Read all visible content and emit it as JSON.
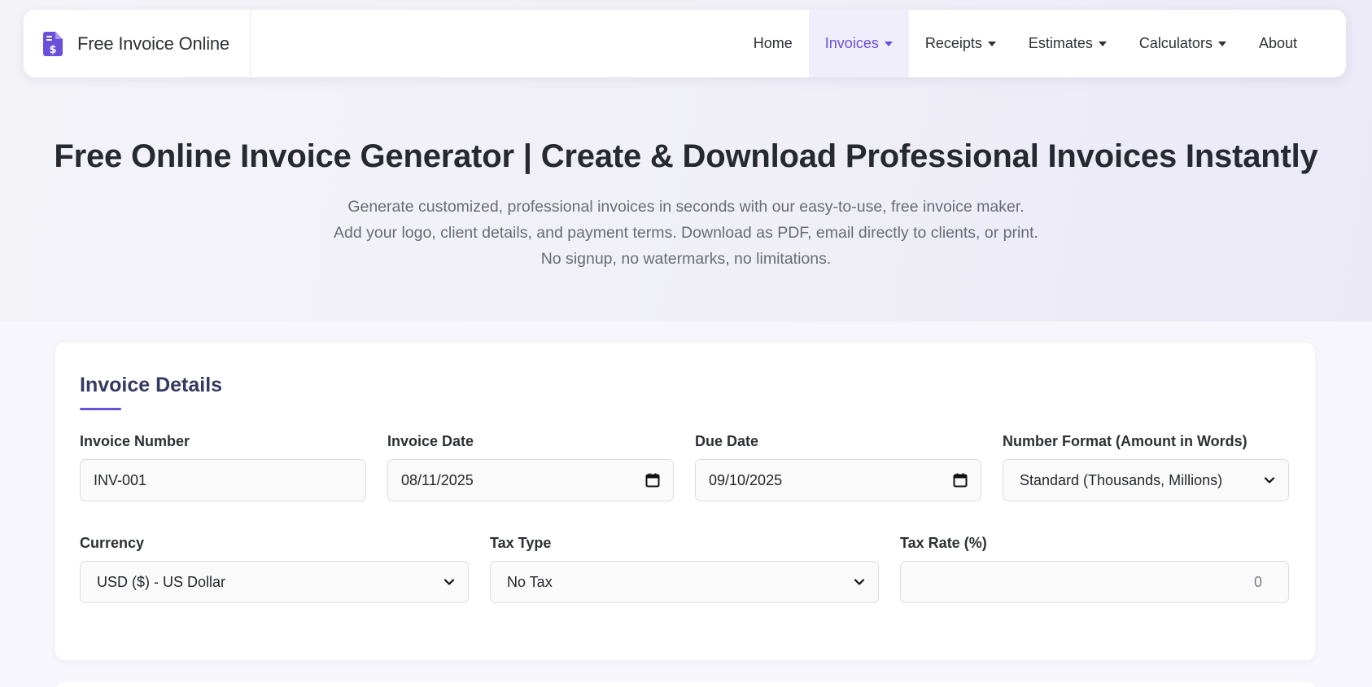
{
  "brand": {
    "name": "Free Invoice Online",
    "icon": "invoice-dollar-icon",
    "color": "#6a4fd8"
  },
  "nav": {
    "items": [
      {
        "label": "Home",
        "dropdown": false,
        "active": false
      },
      {
        "label": "Invoices",
        "dropdown": true,
        "active": true
      },
      {
        "label": "Receipts",
        "dropdown": true,
        "active": false
      },
      {
        "label": "Estimates",
        "dropdown": true,
        "active": false
      },
      {
        "label": "Calculators",
        "dropdown": true,
        "active": false
      },
      {
        "label": "About",
        "dropdown": false,
        "active": false
      }
    ]
  },
  "hero": {
    "title": "Free Online Invoice Generator | Create & Download Professional Invoices Instantly",
    "subtitle": "Generate customized, professional invoices in seconds with our easy-to-use, free invoice maker. Add your logo, client details, and payment terms. Download as PDF, email directly to clients, or print. No signup, no watermarks, no limitations."
  },
  "invoice_details": {
    "title": "Invoice Details",
    "invoice_number": {
      "label": "Invoice Number",
      "value": "INV-001"
    },
    "invoice_date": {
      "label": "Invoice Date",
      "value": "08/11/2025"
    },
    "due_date": {
      "label": "Due Date",
      "value": "09/10/2025"
    },
    "number_format": {
      "label": "Number Format (Amount in Words)",
      "value": "Standard (Thousands, Millions)"
    },
    "currency": {
      "label": "Currency",
      "value": "USD ($) - US Dollar"
    },
    "tax_type": {
      "label": "Tax Type",
      "value": "No Tax"
    },
    "tax_rate": {
      "label": "Tax Rate (%)",
      "value": "0"
    }
  },
  "colors": {
    "accent": "#6a4fd8",
    "active_nav_bg": "#f0eefb",
    "heading": "#262a30"
  }
}
